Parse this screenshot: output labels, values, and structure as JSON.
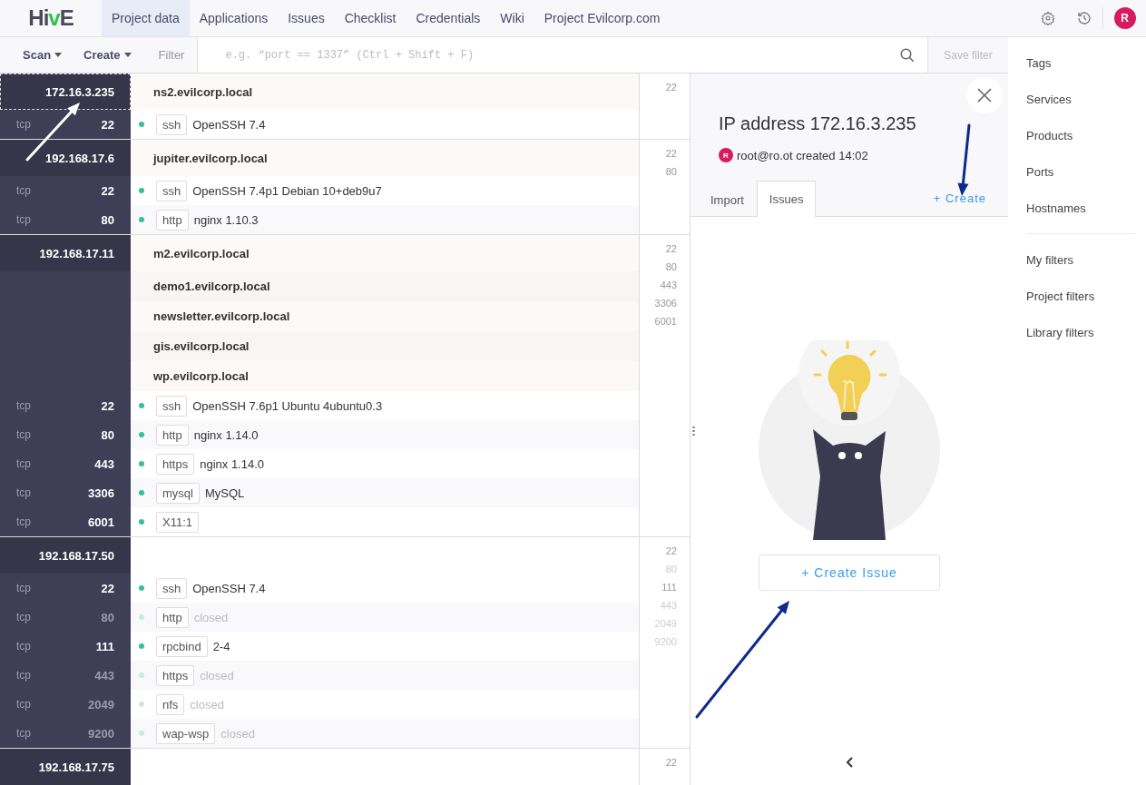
{
  "nav": {
    "logo": "HivE",
    "tabs": [
      {
        "label": "Project data",
        "selected": true
      },
      {
        "label": "Applications",
        "selected": false
      },
      {
        "label": "Issues",
        "selected": false
      },
      {
        "label": "Checklist",
        "selected": false
      },
      {
        "label": "Credentials",
        "selected": false
      },
      {
        "label": "Wiki",
        "selected": false
      },
      {
        "label": "Project Evilcorp.com",
        "selected": false
      }
    ],
    "avatar": "R"
  },
  "toolbar": {
    "scan": "Scan",
    "create": "Create",
    "filter_label": "Filter",
    "filter_placeholder": "e.g. “port == 1337” (Ctrl + Shift + F)",
    "save_filter": "Save filter"
  },
  "hosts": [
    {
      "ip": "172.16.3.235",
      "selected": true,
      "hostnames": [
        "ns2.evilcorp.local"
      ],
      "ports": [
        {
          "protocol": "tcp",
          "port": "22",
          "service": "ssh",
          "product": "OpenSSH 7.4",
          "open": true
        }
      ],
      "port_list": [
        {
          "port": "22",
          "open": true
        }
      ]
    },
    {
      "ip": "192.168.17.6",
      "selected": false,
      "hostnames": [
        "jupiter.evilcorp.local"
      ],
      "ports": [
        {
          "protocol": "tcp",
          "port": "22",
          "service": "ssh",
          "product": "OpenSSH 7.4p1 Debian 10+deb9u7",
          "open": true
        },
        {
          "protocol": "tcp",
          "port": "80",
          "service": "http",
          "product": "nginx 1.10.3",
          "open": true
        }
      ],
      "port_list": [
        {
          "port": "22",
          "open": true
        },
        {
          "port": "80",
          "open": true
        }
      ]
    },
    {
      "ip": "192.168.17.11",
      "selected": false,
      "hostnames": [
        "m2.evilcorp.local",
        "demo1.evilcorp.local",
        "newsletter.evilcorp.local",
        "gis.evilcorp.local",
        "wp.evilcorp.local"
      ],
      "ports": [
        {
          "protocol": "tcp",
          "port": "22",
          "service": "ssh",
          "product": "OpenSSH 7.6p1 Ubuntu 4ubuntu0.3",
          "open": true
        },
        {
          "protocol": "tcp",
          "port": "80",
          "service": "http",
          "product": "nginx 1.14.0",
          "open": true
        },
        {
          "protocol": "tcp",
          "port": "443",
          "service": "https",
          "product": "nginx 1.14.0",
          "open": true
        },
        {
          "protocol": "tcp",
          "port": "3306",
          "service": "mysql",
          "product": "MySQL",
          "open": true
        },
        {
          "protocol": "tcp",
          "port": "6001",
          "service": "X11:1",
          "open": true
        }
      ],
      "port_list": [
        {
          "port": "22",
          "open": true
        },
        {
          "port": "80",
          "open": true
        },
        {
          "port": "443",
          "open": true
        },
        {
          "port": "3306",
          "open": true
        },
        {
          "port": "6001",
          "open": true
        }
      ]
    },
    {
      "ip": "192.168.17.50",
      "selected": false,
      "ports": [
        {
          "protocol": "tcp",
          "port": "22",
          "service": "ssh",
          "product": "OpenSSH 7.4",
          "open": true
        },
        {
          "protocol": "tcp",
          "port": "80",
          "service": "http",
          "product": "closed",
          "open": false
        },
        {
          "protocol": "tcp",
          "port": "111",
          "service": "rpcbind",
          "product": "2-4",
          "open": true
        },
        {
          "protocol": "tcp",
          "port": "443",
          "service": "https",
          "product": "closed",
          "open": false
        },
        {
          "protocol": "tcp",
          "port": "2049",
          "service": "nfs",
          "product": "closed",
          "open": false
        },
        {
          "protocol": "tcp",
          "port": "9200",
          "service": "wap-wsp",
          "product": "closed",
          "open": false
        }
      ],
      "port_list": [
        {
          "port": "22",
          "open": true
        },
        {
          "port": "80",
          "open": false
        },
        {
          "port": "111",
          "open": true
        },
        {
          "port": "443",
          "open": false
        },
        {
          "port": "2049",
          "open": false
        },
        {
          "port": "9200",
          "open": false
        }
      ]
    },
    {
      "ip": "192.168.17.75",
      "selected": false,
      "port_list": [
        {
          "port": "22",
          "open": true
        }
      ]
    }
  ],
  "detail": {
    "title": "IP address 172.16.3.235",
    "avatar": "R",
    "created": "root@ro.ot created 14:02",
    "tabs": [
      {
        "label": "Import",
        "selected": false
      },
      {
        "label": "Issues",
        "selected": true
      }
    ],
    "create_link": "+ Create",
    "create_issue": "+ Create Issue"
  },
  "sidebar": {
    "groups": [
      [
        "Tags",
        "Services",
        "Products",
        "Ports",
        "Hostnames"
      ],
      [
        "My filters",
        "Project filters",
        "Library filters"
      ]
    ]
  }
}
